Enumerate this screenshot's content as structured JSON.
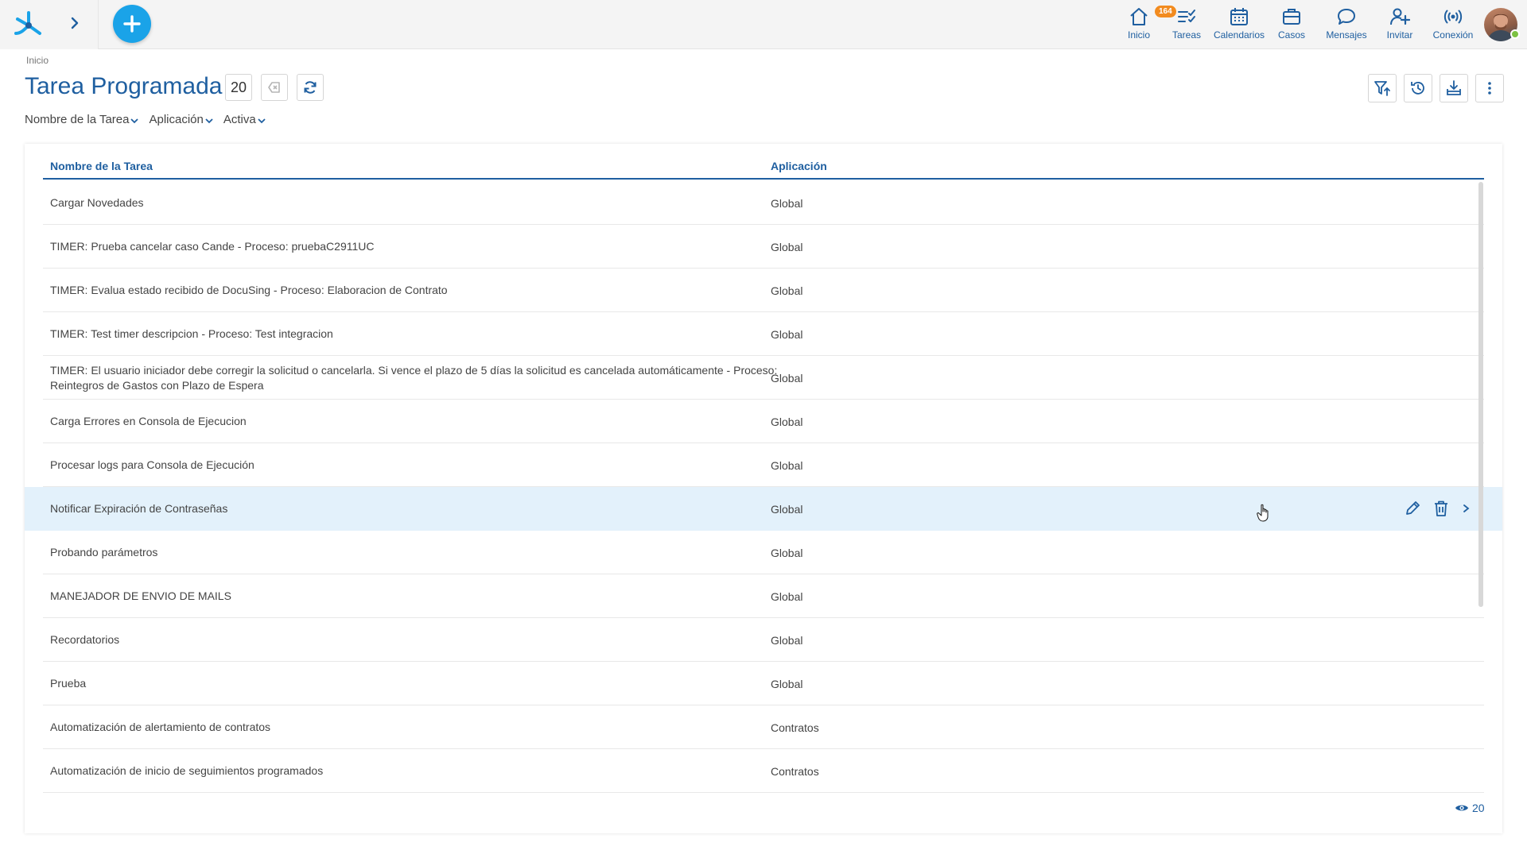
{
  "topbar": {
    "nav": [
      {
        "label": "Inicio",
        "icon": "home-icon"
      },
      {
        "label": "Tareas",
        "icon": "tasks-icon",
        "badge": "164"
      },
      {
        "label": "Calendarios",
        "icon": "calendar-icon"
      },
      {
        "label": "Casos",
        "icon": "briefcase-icon"
      },
      {
        "label": "Mensajes",
        "icon": "message-icon"
      },
      {
        "label": "Invitar",
        "icon": "invite-user-icon"
      },
      {
        "label": "Conexión",
        "icon": "connection-icon"
      }
    ]
  },
  "breadcrumb": "Inicio",
  "page": {
    "title": "Tarea Programada",
    "count": "20"
  },
  "filters": [
    "Nombre de la Tarea",
    "Aplicación",
    "Activa"
  ],
  "table": {
    "columns": [
      "Nombre de la Tarea",
      "Aplicación"
    ],
    "rows": [
      {
        "name": "Cargar Novedades",
        "app": "Global"
      },
      {
        "name": "TIMER: Prueba cancelar caso Cande - Proceso: pruebaC2911UC",
        "app": "Global"
      },
      {
        "name": "TIMER: Evalua estado recibido de DocuSing - Proceso: Elaboracion de Contrato",
        "app": "Global"
      },
      {
        "name": "TIMER: Test timer descripcion - Proceso: Test integracion",
        "app": "Global"
      },
      {
        "name": "TIMER: El usuario iniciador debe corregir la solicitud o cancelarla. Si vence el plazo de 5 días la solicitud es cancelada automáticamente - Proceso: Reintegros de Gastos con Plazo de Espera",
        "app": "Global"
      },
      {
        "name": "Carga Errores en Consola de Ejecucion",
        "app": "Global"
      },
      {
        "name": "Procesar logs para Consola de Ejecución",
        "app": "Global"
      },
      {
        "name": "Notificar Expiración de Contraseñas",
        "app": "Global"
      },
      {
        "name": "Probando parámetros",
        "app": "Global"
      },
      {
        "name": "MANEJADOR DE ENVIO DE MAILS",
        "app": "Global"
      },
      {
        "name": "Recordatorios",
        "app": "Global"
      },
      {
        "name": "Prueba",
        "app": "Global"
      },
      {
        "name": "Automatización de alertamiento de contratos",
        "app": "Contratos"
      },
      {
        "name": "Automatización de inicio de seguimientos programados",
        "app": "Contratos"
      }
    ],
    "highlighted_index": 7
  },
  "footer": {
    "visible_count": "20"
  },
  "colors": {
    "accent": "#1f5fa0",
    "plus": "#1aa3e8",
    "badge": "#f28b1f",
    "highlight": "#e3f1fb"
  }
}
